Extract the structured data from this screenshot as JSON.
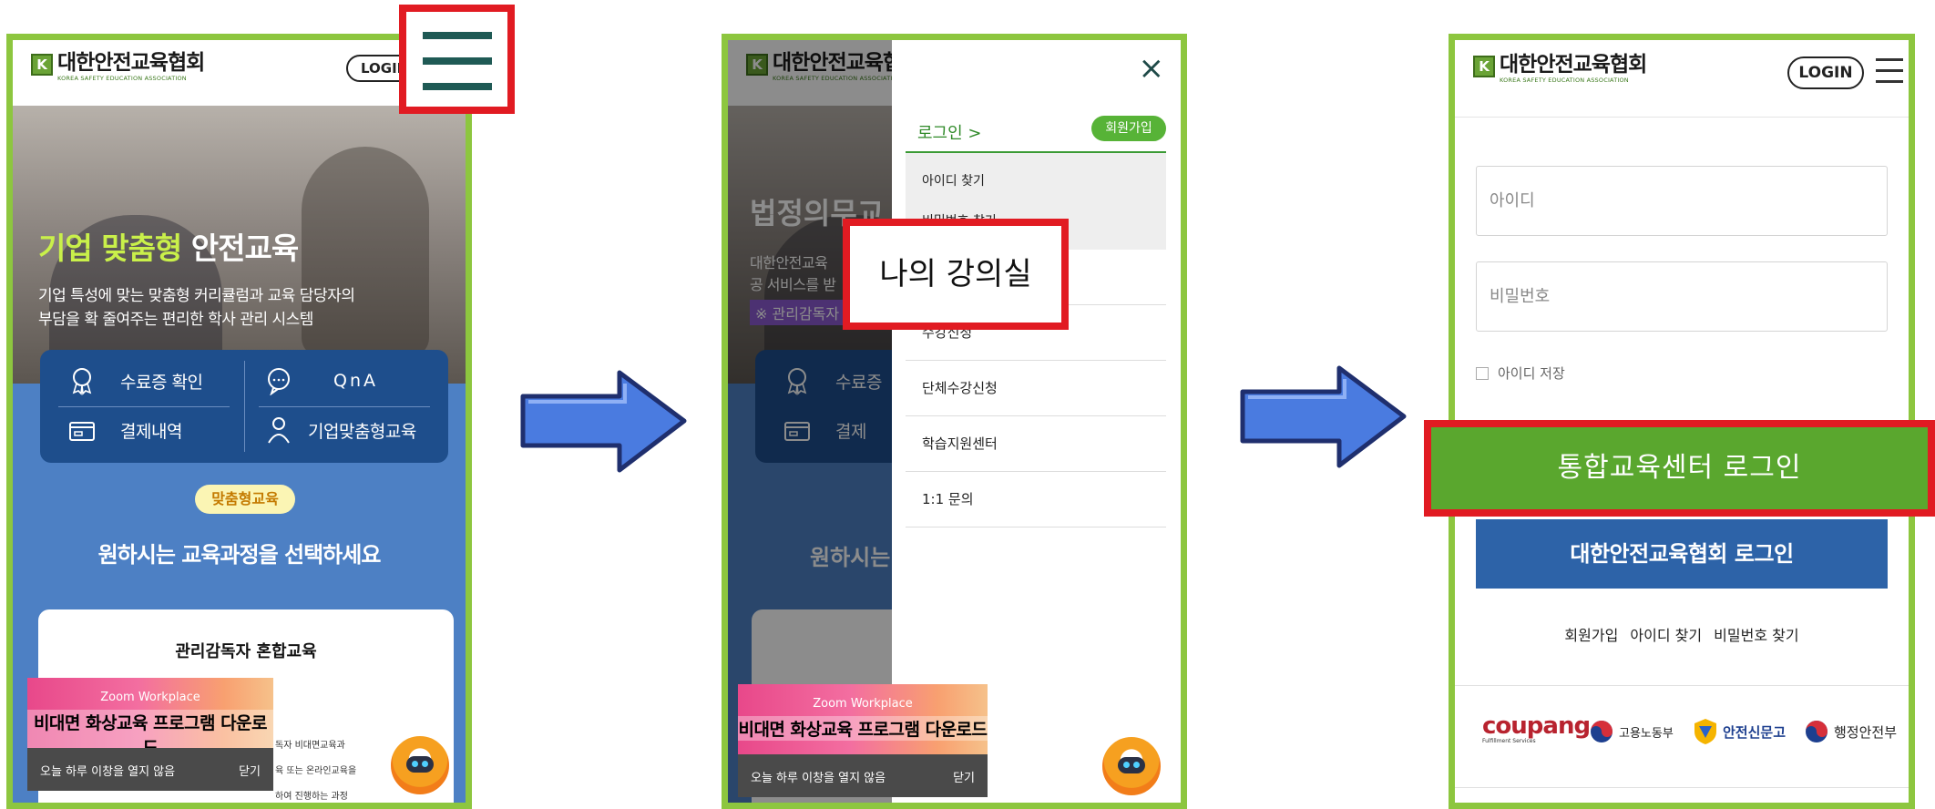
{
  "brand": {
    "name": "대한안전교육협회",
    "sub": "KOREA SAFETY EDUCATION ASSOCIATION",
    "mark": "K"
  },
  "header": {
    "login_label": "LOGIN"
  },
  "step1": {
    "hero_title_highlight": "기업 맞춤형",
    "hero_title_rest": " 안전교육",
    "hero_sub_1": "기업 특성에 맞는 맞춤형 커리큘럼과 교육 담당자의",
    "hero_sub_2": "부담을 확 줄여주는 편리한 학사 관리 시스템",
    "quick_links": [
      "수료증 확인",
      "QnA",
      "결제내역",
      "기업맞춤형교육"
    ],
    "badge": "맞춤형교육",
    "select_title": "원하시는 교육과정을 선택하세요",
    "card_title": "관리감독자 혼합교육",
    "card_lines": [
      "독자 비대면교육과",
      "육 또는 온라인교육을",
      "하여 진행하는 과정"
    ]
  },
  "popup": {
    "zoom": "Zoom Workplace",
    "title": "비대면 화상교육 프로그램 다운로드",
    "dont_show": "오늘 하루 이창을 열지 않음",
    "close": "닫기"
  },
  "step2": {
    "hero_title": "법정의무교",
    "hero_sub_1": "대한안전교육",
    "hero_sub_2": "공 서비스를 받",
    "hero_notice": "※ 관리감독자",
    "quick_partial": [
      "수료증",
      "결제"
    ],
    "select_partial": "원하시는",
    "close_icon": "×",
    "login": "로그인 >",
    "join": "회원가입",
    "find_id": "아이디 찾기",
    "find_pw": "비밀번호 찾기",
    "menu_partial": "수강신청",
    "menu": [
      "단체수강신청",
      "학습지원센터",
      "1:1 문의"
    ],
    "highlight": "나의 강의실"
  },
  "step3": {
    "login_label": "LOGIN",
    "id_placeholder": "아이디",
    "pw_placeholder": "비밀번호",
    "save_id": "아이디 저장",
    "integrated_login": "통합교육센터 로그인",
    "assoc_login": "대한안전교육협회 로그인",
    "links": [
      "회원가입",
      "아이디 찾기",
      "비밀번호 찾기"
    ],
    "partners": [
      "coupang",
      "Fulfillment Services",
      "고용노동부",
      "안전신문고",
      "행정안전부"
    ]
  },
  "colors": {
    "frame": "#8dc63f",
    "callout": "#e11b22",
    "accent_green": "#5aa72e",
    "accent_blue": "#2d63a8",
    "arrow": "#4a7be0"
  }
}
